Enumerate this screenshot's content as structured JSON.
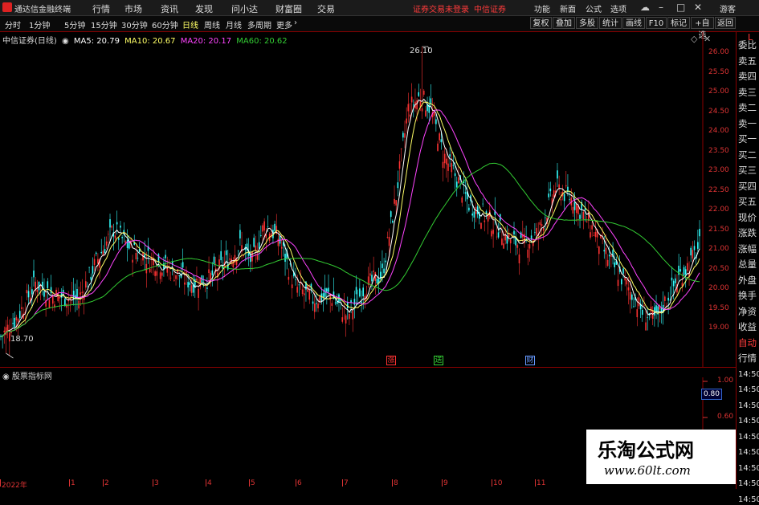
{
  "app": {
    "name": "通达信金融终端"
  },
  "menu": {
    "items": [
      "行情",
      "市场",
      "资讯",
      "发现",
      "问小达",
      "财富圈",
      "交易"
    ],
    "notice_login": "证券交易未登录",
    "notice_broker": "中信证券",
    "right_items": [
      "功能",
      "新面",
      "公式",
      "选项"
    ],
    "guest": "游客"
  },
  "toolbar": {
    "periods": [
      "分时",
      "1分钟",
      "5分钟",
      "15分钟",
      "30分钟",
      "60分钟",
      "日线",
      "周线",
      "月线",
      "多周期",
      "更多"
    ],
    "active": "日线",
    "right_buttons": [
      "复权",
      "叠加",
      "多股",
      "统计",
      "画线",
      "F10",
      "标记",
      "+自选",
      "返回"
    ]
  },
  "legend": {
    "stock": "中信证券(日线)",
    "ma5": "MA5: 20.79",
    "ma10": "MA10: 20.67",
    "ma20": "MA20: 20.17",
    "ma60": "MA60: 20.62",
    "colors": {
      "ma5": "#ffffff",
      "ma10": "#ffff66",
      "ma20": "#ff44ff",
      "ma60": "#33cc33",
      "up": "#ff3333",
      "down": "#33ffff"
    }
  },
  "y_axis_labels": [
    "26.00",
    "25.50",
    "25.00",
    "24.50",
    "24.00",
    "23.50",
    "23.00",
    "22.50",
    "22.00",
    "21.50",
    "21.00",
    "20.50",
    "20.00",
    "19.50",
    "19.00"
  ],
  "annotations": {
    "high": "26.10",
    "low": "18.70"
  },
  "markers": [
    "涨",
    "送",
    "财"
  ],
  "indicator": {
    "title": "股票指标网",
    "values": [
      "1.00",
      "0.80",
      "0.60"
    ],
    "current": "0.80"
  },
  "right_panel": {
    "corner": "L",
    "items": [
      "委比",
      "卖五",
      "卖四",
      "卖三",
      "卖二",
      "卖一",
      "买一",
      "买二",
      "买三",
      "买四",
      "买五",
      "现价",
      "涨跌",
      "涨幅",
      "总量",
      "外盘",
      "换手",
      "净资",
      "收益",
      "自动",
      "行情",
      "14:50",
      "14:50",
      "14:50",
      "14:50",
      "14:50",
      "14:50",
      "14:50",
      "14:50",
      "14:50"
    ]
  },
  "x_axis": {
    "labels": [
      "2022年",
      "1",
      "2",
      "3",
      "4",
      "5",
      "6",
      "7",
      "8",
      "9",
      "10",
      "11"
    ]
  },
  "watermark": {
    "cn": "乐淘公式网",
    "url": "www.60lt.com"
  },
  "chart_data": {
    "type": "candlestick",
    "x": [
      "2022年",
      "1",
      "2",
      "3",
      "4",
      "5",
      "6",
      "7",
      "8",
      "9",
      "10",
      "11"
    ],
    "ylim": [
      18.7,
      26.1
    ],
    "ma_series": [
      {
        "name": "MA5",
        "last": 20.79
      },
      {
        "name": "MA10",
        "last": 20.67
      },
      {
        "name": "MA20",
        "last": 20.17
      },
      {
        "name": "MA60",
        "last": 20.62
      }
    ],
    "high": 26.1,
    "low": 18.7
  }
}
